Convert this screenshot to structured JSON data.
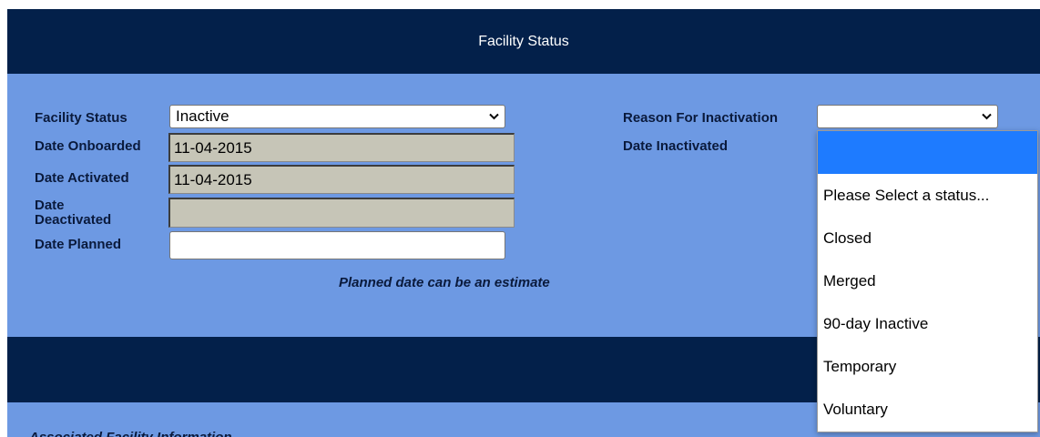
{
  "header": {
    "title": "Facility Status"
  },
  "form": {
    "facility_status_label": "Facility Status",
    "facility_status_value": "Inactive",
    "date_onboarded_label": "Date Onboarded",
    "date_onboarded_value": "11-04-2015",
    "date_activated_label": "Date Activated",
    "date_activated_value": "11-04-2015",
    "date_deactivated_label_line1": "Date",
    "date_deactivated_label_line2": "Deactivated",
    "date_deactivated_value": "",
    "date_planned_label": "Date Planned",
    "date_planned_value": "",
    "planned_hint": "Planned date can be an estimate",
    "reason_label": "Reason For Inactivation",
    "reason_value": "",
    "date_inactivated_label": "Date Inactivated"
  },
  "reason_dropdown": {
    "options": [
      "",
      "Please Select a status...",
      "Closed",
      "Merged",
      "90-day Inactive",
      "Temporary",
      "Voluntary"
    ],
    "highlighted_index": 0,
    "highlight_color": "#1e7bff"
  },
  "section2": {
    "title": "Associated Facility Information"
  },
  "colors": {
    "header_bg": "#03204a",
    "panel_bg": "#6d99e3",
    "disabled_bg": "#c6c5b7"
  }
}
